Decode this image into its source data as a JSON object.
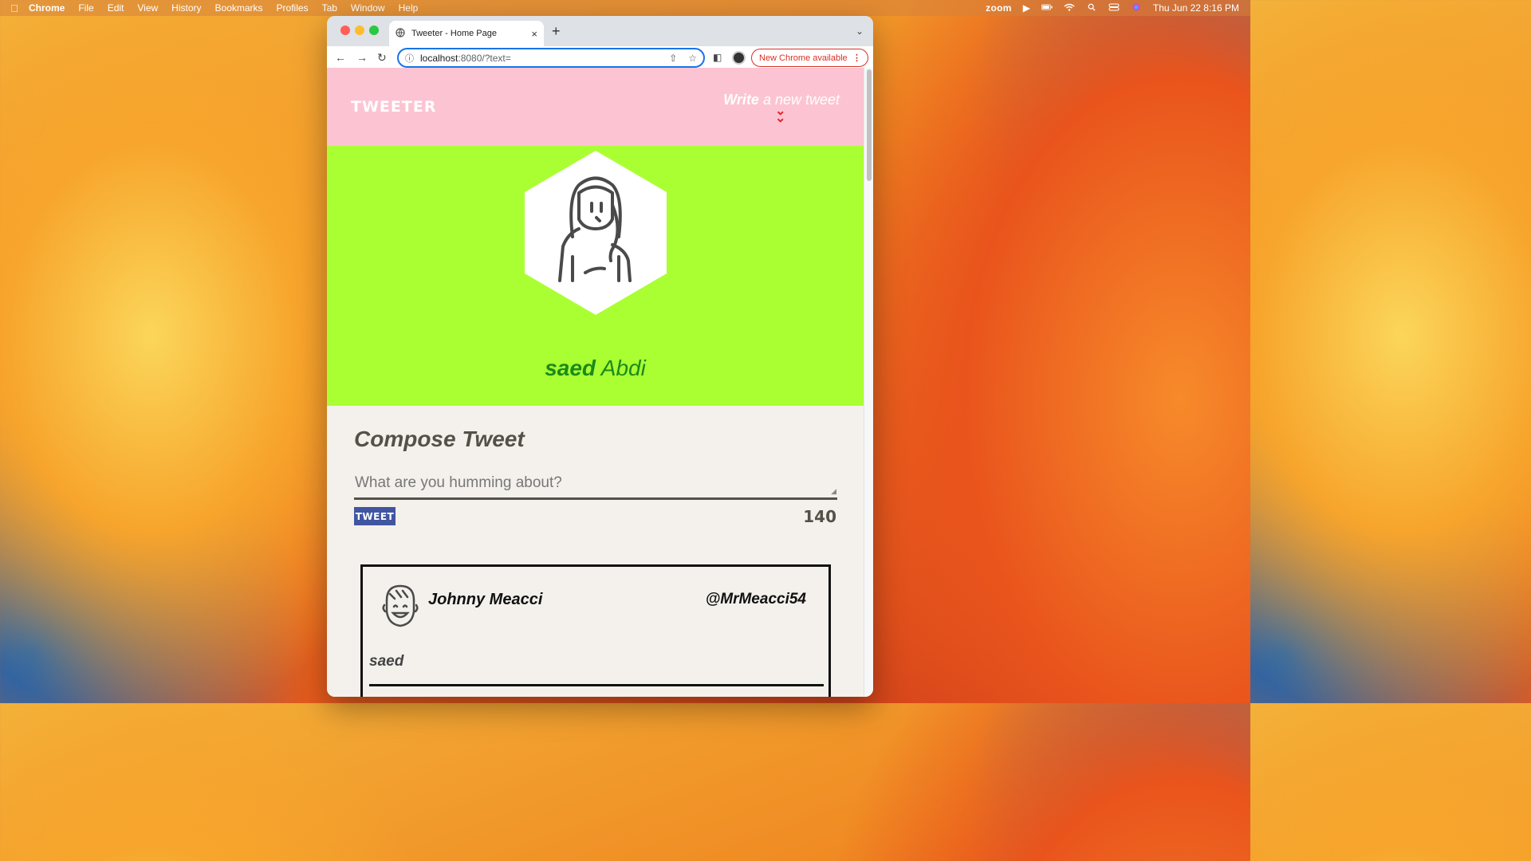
{
  "menubar": {
    "app": "Chrome",
    "items": [
      "File",
      "Edit",
      "View",
      "History",
      "Bookmarks",
      "Profiles",
      "Tab",
      "Window",
      "Help"
    ],
    "zoom": "zoom",
    "datetime": "Thu Jun 22  8:16 PM"
  },
  "browser": {
    "tab_title": "Tweeter - Home Page",
    "url_host": "localhost",
    "url_path": ":8080/?text=",
    "update_label": "New Chrome available"
  },
  "nav": {
    "brand": "TWEETER",
    "compose_bold": "Write",
    "compose_rest": "a new tweet"
  },
  "profile": {
    "first_name": "saed",
    "last_name": "Abdi"
  },
  "compose": {
    "title": "Compose Tweet",
    "placeholder": "What are you humming about?",
    "button": "TWEET",
    "counter": "140"
  },
  "tweets": [
    {
      "name": "Johnny Meacci",
      "handle": "@MrMeacci54",
      "content": "saed"
    }
  ],
  "colors": {
    "nav_bg": "#fcc4d2",
    "profile_bg": "#aaff33",
    "page_bg": "#f4f1ec",
    "tweet_button": "#4056a1",
    "accent_red": "#e8202a",
    "name_green": "#1a8a1a"
  }
}
